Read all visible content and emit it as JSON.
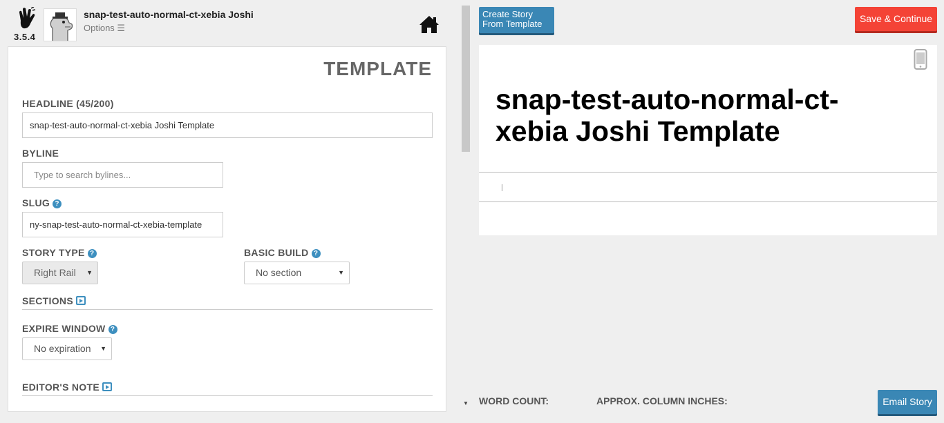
{
  "app": {
    "version": "3.5.4",
    "user_name": "snap-test-auto-normal-ct-xebia Joshi",
    "options_label": "Options ☰"
  },
  "form": {
    "title": "TEMPLATE",
    "headline_label": "HEADLINE (45/200)",
    "headline_value": "snap-test-auto-normal-ct-xebia Joshi Template",
    "byline_label": "BYLINE",
    "byline_placeholder": "Type to search bylines...",
    "slug_label": "SLUG",
    "slug_value": "ny-snap-test-auto-normal-ct-xebia-template",
    "story_type_label": "STORY TYPE",
    "story_type_value": "Right Rail",
    "basic_build_label": "BASIC BUILD",
    "basic_build_value": "No section",
    "sections_label": "SECTIONS",
    "expire_window_label": "EXPIRE WINDOW",
    "expire_window_value": "No expiration",
    "editors_note_label": "EDITOR'S NOTE"
  },
  "toolbar": {
    "create_from_template_line1": "Create Story",
    "create_from_template_line2": "From Template",
    "save_continue": "Save & Continue",
    "email_story": "Email Story"
  },
  "preview": {
    "headline": "snap-test-auto-normal-ct-xebia Joshi Template"
  },
  "footer": {
    "word_count_label": "WORD COUNT:",
    "column_inches_label": "APPROX. COLUMN INCHES:"
  },
  "colors": {
    "primary_blue": "#3a87b5",
    "save_red": "#f44336",
    "help_blue": "#3d8fbf"
  }
}
